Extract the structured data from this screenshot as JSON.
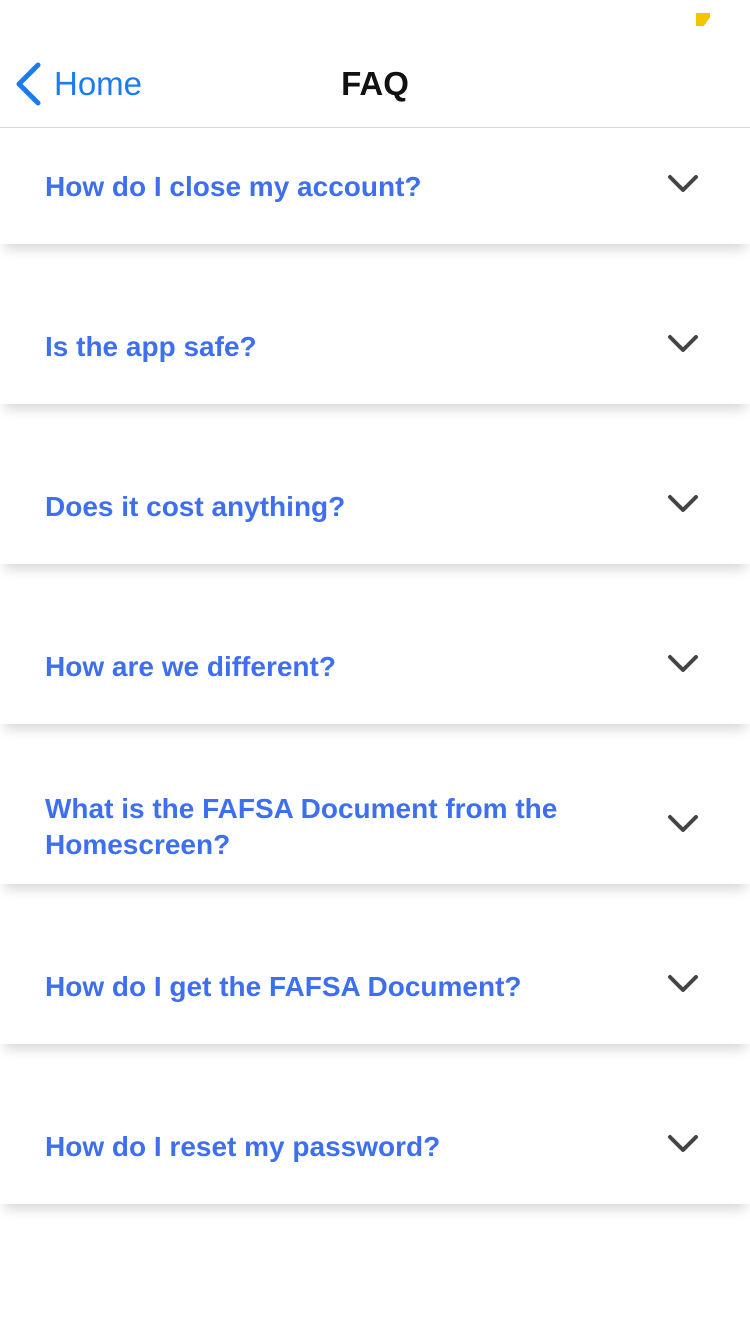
{
  "status_bar": {
    "battery_color": "#f5c400"
  },
  "nav": {
    "back_label": "Home",
    "title": "FAQ",
    "accent_color": "#1a7cf0"
  },
  "faq": {
    "question_color": "#3d6ff0",
    "items": [
      {
        "question": "How do I close my account?",
        "icon": "chevron-down-icon"
      },
      {
        "question": "Is the app safe?",
        "icon": "chevron-down-icon"
      },
      {
        "question": "Does it cost anything?",
        "icon": "chevron-down-icon"
      },
      {
        "question": "How are we different?",
        "icon": "chevron-down-icon"
      },
      {
        "question": "What is the FAFSA Document from the Homescreen?",
        "icon": "chevron-down-icon"
      },
      {
        "question": "How do I get the FAFSA Document?",
        "icon": "chevron-down-icon"
      },
      {
        "question": "How do I reset my password?",
        "icon": "chevron-down-icon"
      }
    ]
  }
}
